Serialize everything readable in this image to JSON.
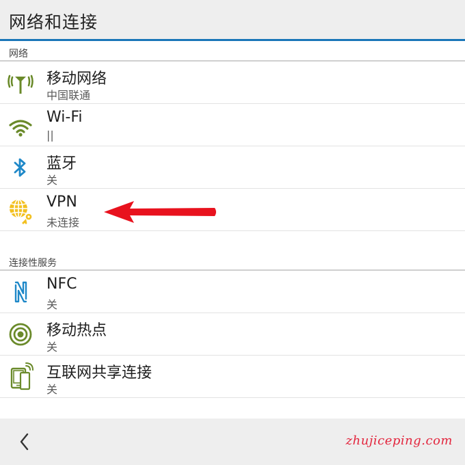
{
  "header": {
    "title": "网络和连接"
  },
  "sections": [
    {
      "title": "网络",
      "items": [
        {
          "label": "移动网络",
          "sub": "中国联通",
          "icon": "cellular-antenna-icon"
        },
        {
          "label": "Wi-Fi",
          "sub": "||",
          "icon": "wifi-icon"
        },
        {
          "label": "蓝牙",
          "sub": "关",
          "icon": "bluetooth-icon"
        },
        {
          "label": "VPN",
          "sub": "未连接",
          "icon": "vpn-globe-key-icon"
        }
      ]
    },
    {
      "title": "连接性服务",
      "items": [
        {
          "label": "NFC",
          "sub": "关",
          "icon": "nfc-icon"
        },
        {
          "label": "移动热点",
          "sub": "关",
          "icon": "hotspot-icon"
        },
        {
          "label": "互联网共享连接",
          "sub": "关",
          "icon": "tethering-icon"
        }
      ]
    }
  ],
  "footer": {
    "watermark": "zhujiceping.com"
  },
  "colors": {
    "accent": "#1a76b8",
    "icon_green": "#6a8a2a",
    "bluetooth_blue": "#1e88c8",
    "vpn_yellow": "#f2c020",
    "arrow_red": "#e8121e"
  }
}
